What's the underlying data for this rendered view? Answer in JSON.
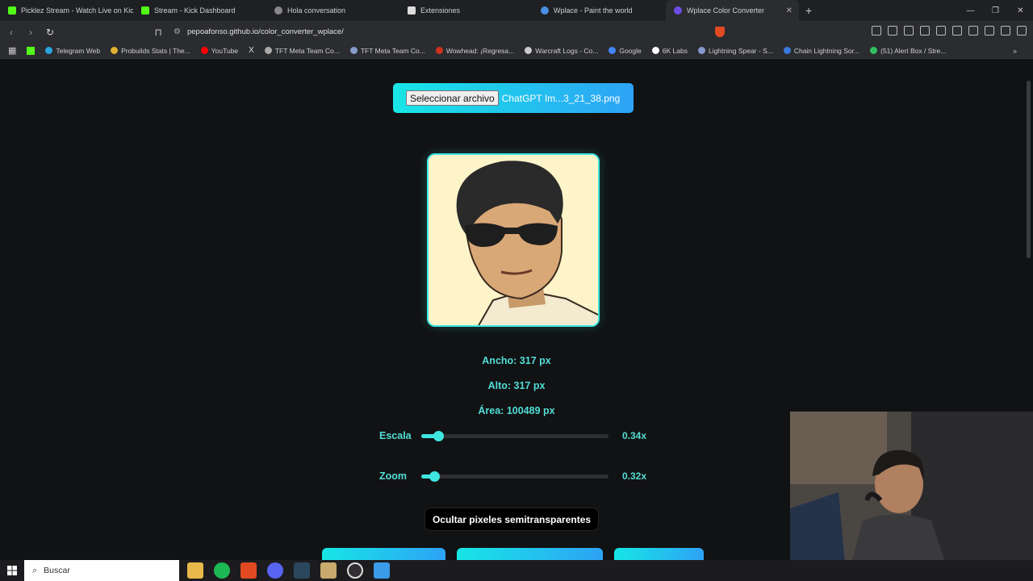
{
  "browser": {
    "tabs": [
      {
        "label": "Picklez Stream - Watch Live on Kick",
        "color": "#53fc18"
      },
      {
        "label": "Stream - Kick Dashboard",
        "color": "#53fc18"
      },
      {
        "label": "Hola conversation",
        "color": "#bbbbbb"
      },
      {
        "label": "Extensiones",
        "color": "#dddddd"
      },
      {
        "label": "Wplace - Paint the world",
        "color": "#4a90e2"
      },
      {
        "label": "Wplace Color Converter",
        "color": "#6b4de6",
        "active": true
      }
    ],
    "url": "pepoafonso.github.io/color_converter_wplace/",
    "bookmarks": [
      {
        "label": "Telegram Web",
        "color": "#2aa3e0"
      },
      {
        "label": "Probuilds Stats | The...",
        "color": "#e0b030"
      },
      {
        "label": "YouTube",
        "color": "#ff0000"
      },
      {
        "label": "TFT Meta Team Co...",
        "color": "#aaaaaa"
      },
      {
        "label": "TFT Meta Team Co...",
        "color": "#8899cc"
      },
      {
        "label": "Wowhead: ¡Regresa...",
        "color": "#d03020"
      },
      {
        "label": "Warcraft Logs - Co...",
        "color": "#cccccc"
      },
      {
        "label": "Google",
        "color": "#4285f4"
      },
      {
        "label": "6K Labs",
        "color": "#ffffff"
      },
      {
        "label": "Lightning Spear - S...",
        "color": "#8899cc"
      },
      {
        "label": "Chain Lightning Sor...",
        "color": "#3a78e0"
      },
      {
        "label": "(51) Alert Box / Stre...",
        "color": "#30c060"
      }
    ]
  },
  "page": {
    "file_button": "Seleccionar archivo",
    "file_name": "ChatGPT Im...3_21_38.png",
    "width_label": "Ancho: 317 px",
    "height_label": "Alto: 317 px",
    "area_label": "Área: 100489 px",
    "scale": {
      "label": "Escala",
      "value_text": "0.34x",
      "fraction": 0.09
    },
    "zoom": {
      "label": "Zoom",
      "value_text": "0.32x",
      "fraction": 0.07
    },
    "hide_button": "Ocultar pixeles semitransparentes"
  },
  "taskbar": {
    "search_placeholder": "Buscar"
  },
  "colors": {
    "accent": "#3fe6e0",
    "accent_text": "#52ddd5",
    "gradient_end": "#2da3f5"
  }
}
